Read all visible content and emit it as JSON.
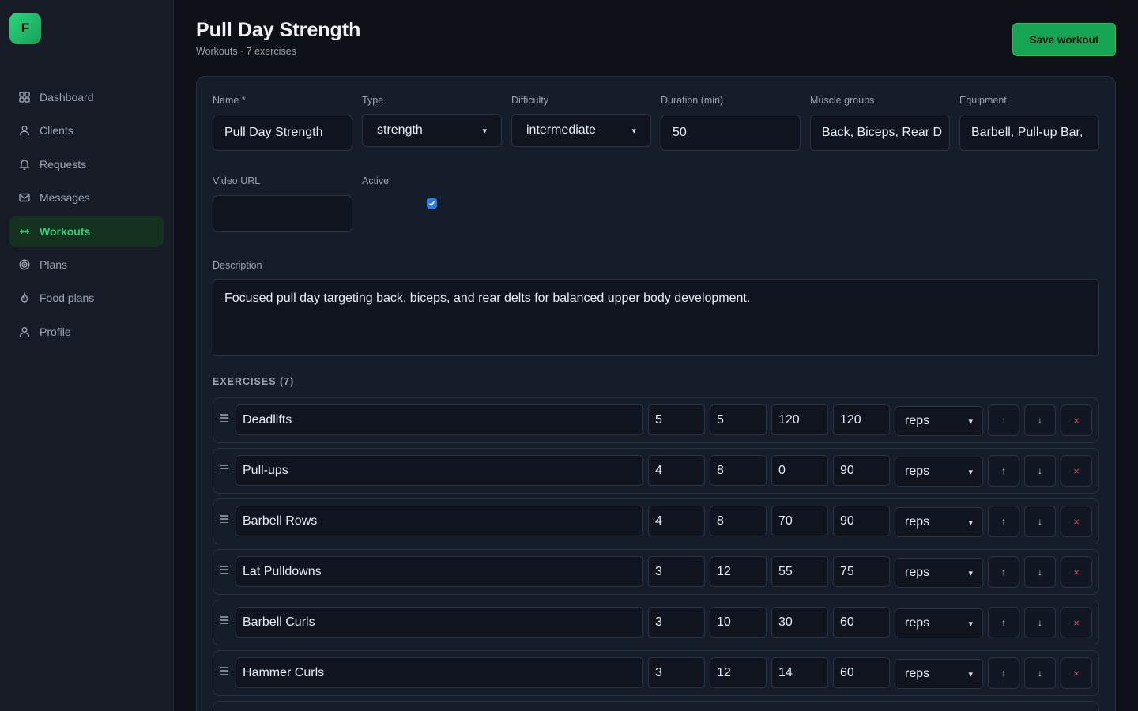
{
  "logo": {
    "letter": "F"
  },
  "sidebar": {
    "items": [
      {
        "label": "Dashboard",
        "icon": "grid-icon"
      },
      {
        "label": "Clients",
        "icon": "user-icon"
      },
      {
        "label": "Requests",
        "icon": "bell-icon"
      },
      {
        "label": "Messages",
        "icon": "mail-icon"
      },
      {
        "label": "Workouts",
        "icon": "dumbbell-icon",
        "active": true
      },
      {
        "label": "Plans",
        "icon": "target-icon"
      },
      {
        "label": "Food plans",
        "icon": "flame-icon"
      },
      {
        "label": "Profile",
        "icon": "user-icon"
      }
    ]
  },
  "header": {
    "title": "Pull Day Strength",
    "subtitle": "Workouts · 7 exercises",
    "save_label": "Save workout"
  },
  "form": {
    "name_label": "Name *",
    "name_value": "Pull Day Strength",
    "type_label": "Type",
    "type_value": "strength",
    "difficulty_label": "Difficulty",
    "difficulty_value": "intermediate",
    "duration_label": "Duration (min)",
    "duration_value": "50",
    "muscle_label": "Muscle groups",
    "muscle_value": "Back, Biceps, Rear D",
    "equipment_label": "Equipment",
    "equipment_value": "Barbell, Pull-up Bar,",
    "video_label": "Video URL",
    "video_value": "",
    "active_label": "Active",
    "active_checked": true,
    "description_label": "Description",
    "description_value": "Focused pull day targeting back, biceps, and rear delts for balanced upper body development."
  },
  "exercises": {
    "title": "EXERCISES (7)",
    "rows": [
      {
        "name": "Deadlifts",
        "sets": "5",
        "reps": "5",
        "weight": "120",
        "rest": "120",
        "unit": "reps"
      },
      {
        "name": "Pull-ups",
        "sets": "4",
        "reps": "8",
        "weight": "0",
        "rest": "90",
        "unit": "reps"
      },
      {
        "name": "Barbell Rows",
        "sets": "4",
        "reps": "8",
        "weight": "70",
        "rest": "90",
        "unit": "reps"
      },
      {
        "name": "Lat Pulldowns",
        "sets": "3",
        "reps": "12",
        "weight": "55",
        "rest": "75",
        "unit": "reps"
      },
      {
        "name": "Barbell Curls",
        "sets": "3",
        "reps": "10",
        "weight": "30",
        "rest": "60",
        "unit": "reps"
      },
      {
        "name": "Hammer Curls",
        "sets": "3",
        "reps": "12",
        "weight": "14",
        "rest": "60",
        "unit": "reps"
      }
    ],
    "up_symbol": "↑",
    "down_symbol": "↓",
    "delete_symbol": "×"
  }
}
